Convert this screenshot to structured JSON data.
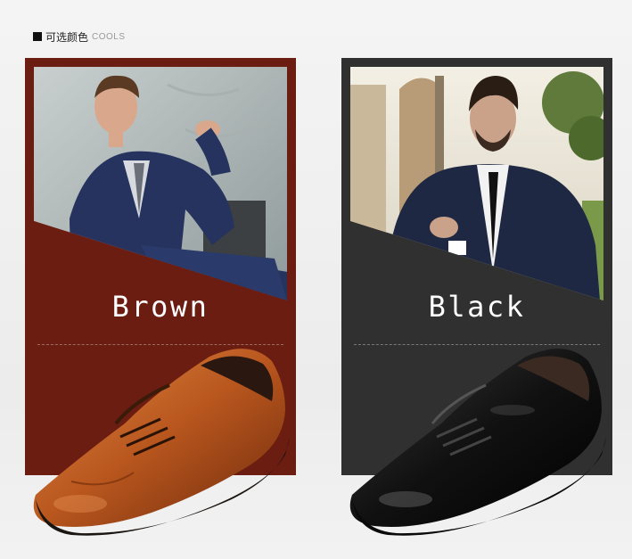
{
  "header": {
    "cn": "可选颜色",
    "en": "COOLS"
  },
  "colors": [
    {
      "label": "Brown",
      "panel": "#6b1d12",
      "shoe": "#b8561e"
    },
    {
      "label": "Black",
      "panel": "#303030",
      "shoe": "#111111"
    }
  ]
}
